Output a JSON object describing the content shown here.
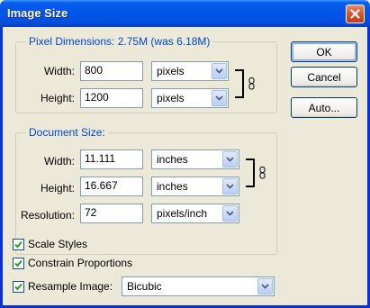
{
  "window": {
    "title": "Image Size",
    "close_icon": "close-icon"
  },
  "pixel_dimensions": {
    "label": "Pixel Dimensions:",
    "size_text": "2.75M (was 6.18M)",
    "width": {
      "label": "Width:",
      "value": "800",
      "unit": "pixels"
    },
    "height": {
      "label": "Height:",
      "value": "1200",
      "unit": "pixels"
    }
  },
  "document_size": {
    "label": "Document Size:",
    "width": {
      "label": "Width:",
      "value": "11.111",
      "unit": "inches"
    },
    "height": {
      "label": "Height:",
      "value": "16.667",
      "unit": "inches"
    },
    "resolution": {
      "label": "Resolution:",
      "value": "72",
      "unit": "pixels/inch"
    }
  },
  "buttons": {
    "ok": "OK",
    "cancel": "Cancel",
    "auto": "Auto..."
  },
  "options": {
    "scale_styles": {
      "label": "Scale Styles",
      "checked": true
    },
    "constrain_proportions": {
      "label": "Constrain Proportions",
      "checked": true
    },
    "resample_image": {
      "label": "Resample Image:",
      "checked": true,
      "method": "Bicubic"
    }
  },
  "colors": {
    "group_label": "#0046d5",
    "titlebar": "#0055e5",
    "close": "#d4502c"
  }
}
